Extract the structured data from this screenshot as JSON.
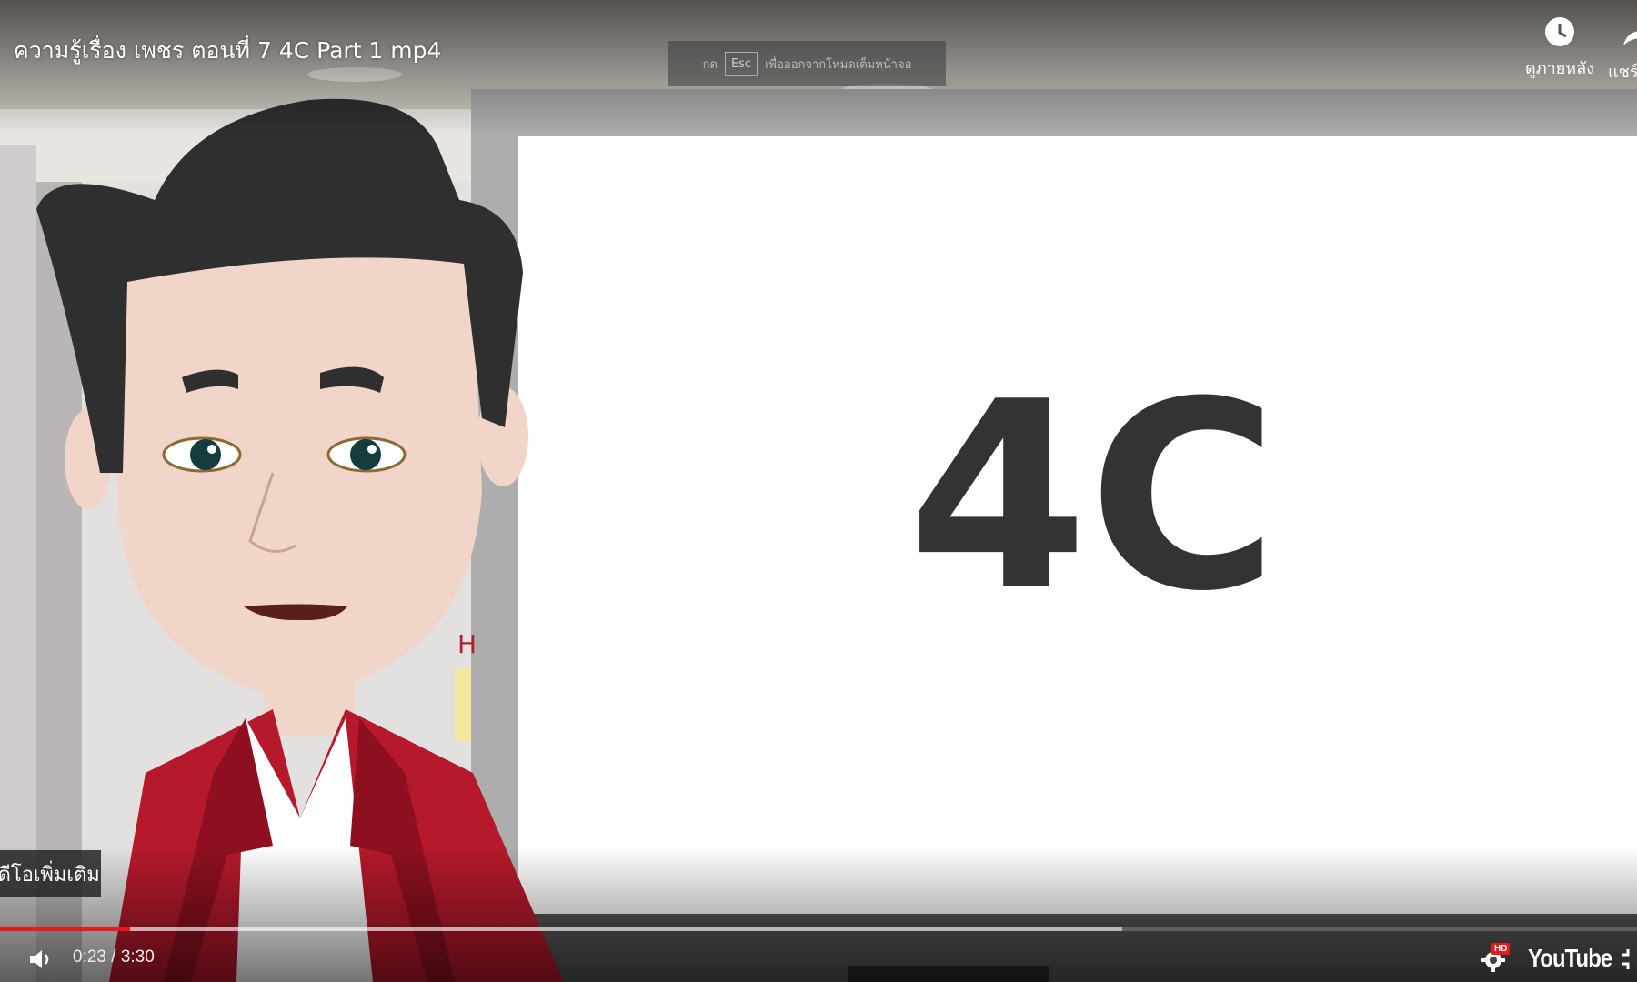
{
  "video": {
    "title": "ความรู้เรื่อง เพชร ตอนที่ 7 4C Part 1 mp4",
    "slide_text": "4C",
    "fragment_letter": "H"
  },
  "fullscreen_hint": {
    "prefix": "กด",
    "key": "Esc",
    "suffix": "เพื่อออกจากโหมดเต็มหน้าจอ"
  },
  "top_actions": {
    "watch_later_label": "ดูภายหลัง",
    "share_label": "แชร์"
  },
  "more_videos_label": "วิดีโอเพิ่มเติม",
  "playback": {
    "current_time": "0:23",
    "separator": " / ",
    "duration": "3:30",
    "played_fraction": 0.0797,
    "buffered_fraction": 0.6855,
    "quality_badge": "HD"
  },
  "branding": {
    "logo_text": "YouTube"
  },
  "colors": {
    "progress_played": "#e6191b",
    "badge": "#e6191b"
  }
}
